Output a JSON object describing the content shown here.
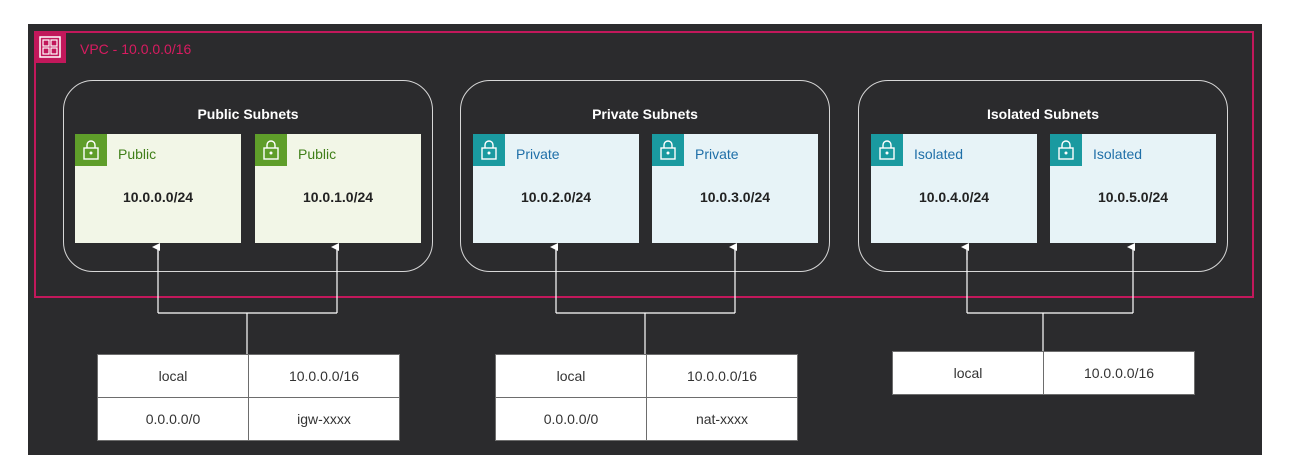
{
  "vpc": {
    "label": "VPC - 10.0.0.0/16",
    "accent": "#c2185b",
    "icon": "vpc-icon"
  },
  "groups": [
    {
      "title": "Public Subnets",
      "subnets": [
        {
          "name": "Public",
          "cidr": "10.0.0.0/24",
          "icon": "lock-icon"
        },
        {
          "name": "Public",
          "cidr": "10.0.1.0/24",
          "icon": "lock-icon"
        }
      ],
      "route_table": [
        [
          "local",
          "10.0.0.0/16"
        ],
        [
          "0.0.0.0/0",
          "igw-xxxx"
        ]
      ]
    },
    {
      "title": "Private Subnets",
      "subnets": [
        {
          "name": "Private",
          "cidr": "10.0.2.0/24",
          "icon": "lock-icon"
        },
        {
          "name": "Private",
          "cidr": "10.0.3.0/24",
          "icon": "lock-icon"
        }
      ],
      "route_table": [
        [
          "local",
          "10.0.0.0/16"
        ],
        [
          "0.0.0.0/0",
          "nat-xxxx"
        ]
      ]
    },
    {
      "title": "Isolated Subnets",
      "subnets": [
        {
          "name": "Isolated",
          "cidr": "10.0.4.0/24",
          "icon": "lock-icon"
        },
        {
          "name": "Isolated",
          "cidr": "10.0.5.0/24",
          "icon": "lock-icon"
        }
      ],
      "route_table": [
        [
          "local",
          "10.0.0.0/16"
        ]
      ]
    }
  ],
  "colors": {
    "background": "#2b2b2d",
    "public_fill": "#f2f6e7",
    "public_icon": "#5f9e2a",
    "private_fill": "#e7f3f7",
    "private_icon": "#1a9aa0"
  }
}
